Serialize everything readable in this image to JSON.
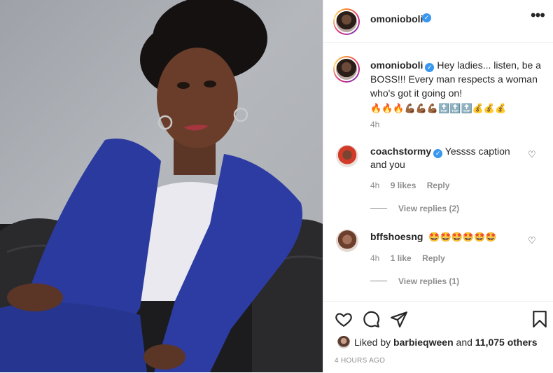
{
  "post": {
    "author": "omonioboli",
    "caption_text": "Hey ladies... listen, be a BOSS!!! Every man respects a woman who's got it going on!",
    "caption_emojis": "🔥🔥🔥💪🏾💪🏾💪🏾🔝🔝🔝💰💰💰",
    "caption_time": "4h"
  },
  "comments": [
    {
      "user": "coachstormy",
      "verified": true,
      "text": "Yessss caption and you",
      "time": "4h",
      "likes": "9 likes",
      "reply": "Reply",
      "view_replies": "View replies (2)"
    },
    {
      "user": "bffshoesng",
      "verified": false,
      "text": "🤩🤩🤩🤩🤩🤩",
      "time": "4h",
      "likes": "1 like",
      "reply": "Reply",
      "view_replies": "View replies (1)"
    }
  ],
  "likes_line": {
    "prefix": "Liked by",
    "user": "barbieqween",
    "middle": "and",
    "count": "11,075 others"
  },
  "timestamp": "4 HOURS AGO",
  "icons": {
    "more": "more-options-icon",
    "like": "heart-icon",
    "comment": "comment-icon",
    "share": "paper-plane-icon",
    "save": "bookmark-icon",
    "verified": "verified-badge-icon"
  },
  "colors": {
    "verified": "#3897f0",
    "muted": "#8e8e8e",
    "blazer": "#2b3a9e"
  }
}
